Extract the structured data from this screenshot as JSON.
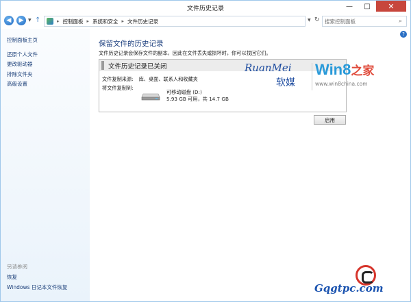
{
  "window": {
    "title": "文件历史记录",
    "controls": {
      "minimize": "—",
      "maximize": "□",
      "close": "✕"
    }
  },
  "address": {
    "crumbs": [
      "控制面板",
      "系统和安全",
      "文件历史记录"
    ],
    "separator": "▸",
    "search_placeholder": "搜索控制面板"
  },
  "sidebar": {
    "home": "控制面板主页",
    "items": [
      "还原个人文件",
      "更改驱动器",
      "排除文件夹",
      "高级设置"
    ],
    "see_also": "另请参阅",
    "sub_items": [
      "恢复",
      "Windows 日记本文件恢复"
    ]
  },
  "main": {
    "title": "保留文件的历史记录",
    "description": "文件历史记录会保存文件的副本，因此在文件丢失或损坏时，你可以找回它们。",
    "panel": {
      "status": "文件历史记录已关闭",
      "source_label": "文件复制来源:",
      "source_value": "库、桌面、联系人和收藏夹",
      "target_label": "将文件复制到:",
      "drive_name": "可移动磁盘 (D:)",
      "drive_space": "5.93 GB 可用，共 14.7 GB"
    },
    "enable_button": "启用",
    "help_label": "?"
  },
  "watermark": {
    "brand_latin": "RuanMei",
    "brand_cn": "软媒",
    "site": "Win8",
    "site_cn": "之家",
    "url": "www.win8china.com"
  },
  "corner_logo": {
    "text": "Gqgtpc.com"
  },
  "colors": {
    "accent": "#1b3e7e",
    "link": "#1a3e78",
    "close": "#c7463c",
    "win8_blue": "#2a9ad9",
    "win8_red": "#e04a3a"
  },
  "icons": {
    "back": "back-arrow-icon",
    "forward": "forward-arrow-icon",
    "up": "up-arrow-icon",
    "refresh": "refresh-icon",
    "search": "search-icon",
    "help": "help-icon",
    "drive": "removable-drive-icon"
  }
}
